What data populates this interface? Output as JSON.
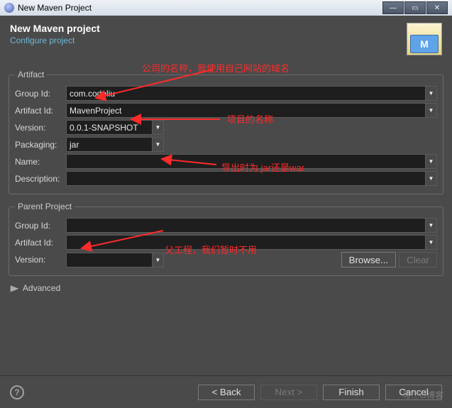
{
  "window": {
    "title": "New Maven Project"
  },
  "header": {
    "title": "New Maven project",
    "subtitle": "Configure project",
    "iconLetter": "M"
  },
  "artifact": {
    "legend": "Artifact",
    "groupIdLabel": "Group Id:",
    "groupId": "com.codeliu",
    "artifactIdLabel": "Artifact Id:",
    "artifactId": "MavenProject",
    "versionLabel": "Version:",
    "version": "0.0.1-SNAPSHOT",
    "packagingLabel": "Packaging:",
    "packaging": "jar",
    "nameLabel": "Name:",
    "name": "",
    "descriptionLabel": "Description:",
    "description": ""
  },
  "parent": {
    "legend": "Parent Project",
    "groupIdLabel": "Group Id:",
    "groupId": "",
    "artifactIdLabel": "Artifact Id:",
    "artifactId": "",
    "versionLabel": "Version:",
    "version": "",
    "browse": "Browse...",
    "clear": "Clear"
  },
  "advanced": "Advanced",
  "footer": {
    "back": "< Back",
    "next": "Next >",
    "finish": "Finish",
    "cancel": "Cancel"
  },
  "annotations": {
    "a1": "公司的名称，我使用自己网站的域名",
    "a2": "项目的名称",
    "a3": "导出时为 jar还是war",
    "a4": "父工程，我们暂时不用"
  },
  "watermark": "写①O博客"
}
